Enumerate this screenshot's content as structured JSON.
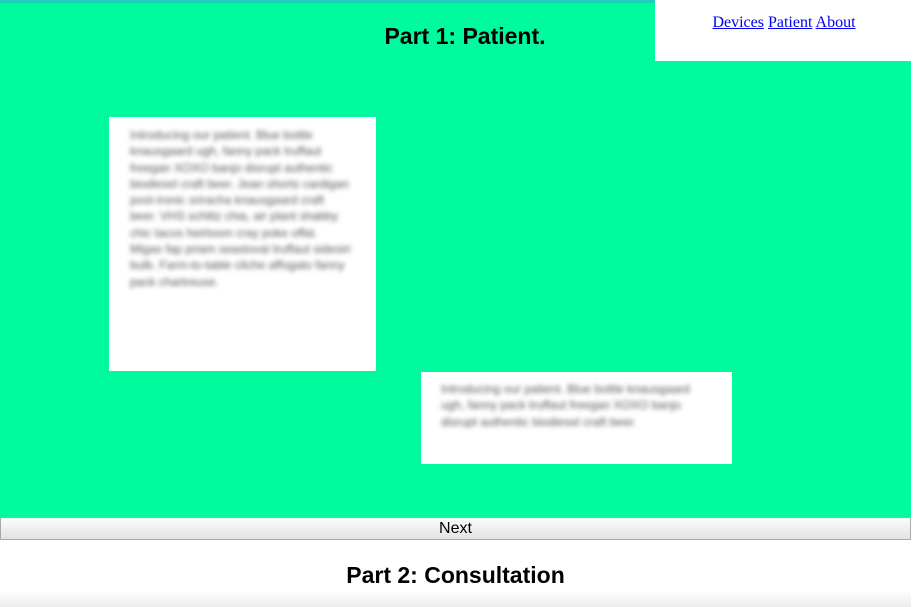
{
  "section1": {
    "title": "Part 1: Patient.",
    "card1_text": "Introducing our patient. Blue bottle knausgaard ugh, fanny pack truffaut freegan XOXO banjo disrupt authentic biodiesel craft beer. Jean shorts cardigan post-ironic sriracha knausgaard craft beer. VHS schlitz chia, air plant shabby chic tacos heirloom cray poke offal. Migas fap priam seastoval truffaut sidesiri bulb. Farm-to-table cliche affogato fanny pack chartreuse.",
    "card2_text": "Introducing our patient. Blue bottle knausgaard ugh, fanny pack truffaut freegan XOXO banjo disrupt authentic biodiesel craft beer."
  },
  "nav": {
    "links": [
      "Devices",
      "Patient",
      "About"
    ]
  },
  "next_button": {
    "label": "Next"
  },
  "section2": {
    "title": "Part 2: Consultation"
  },
  "colors": {
    "section1_background": "#00fa9e",
    "top_border": "#1ecfc0",
    "link": "#0000ee"
  }
}
